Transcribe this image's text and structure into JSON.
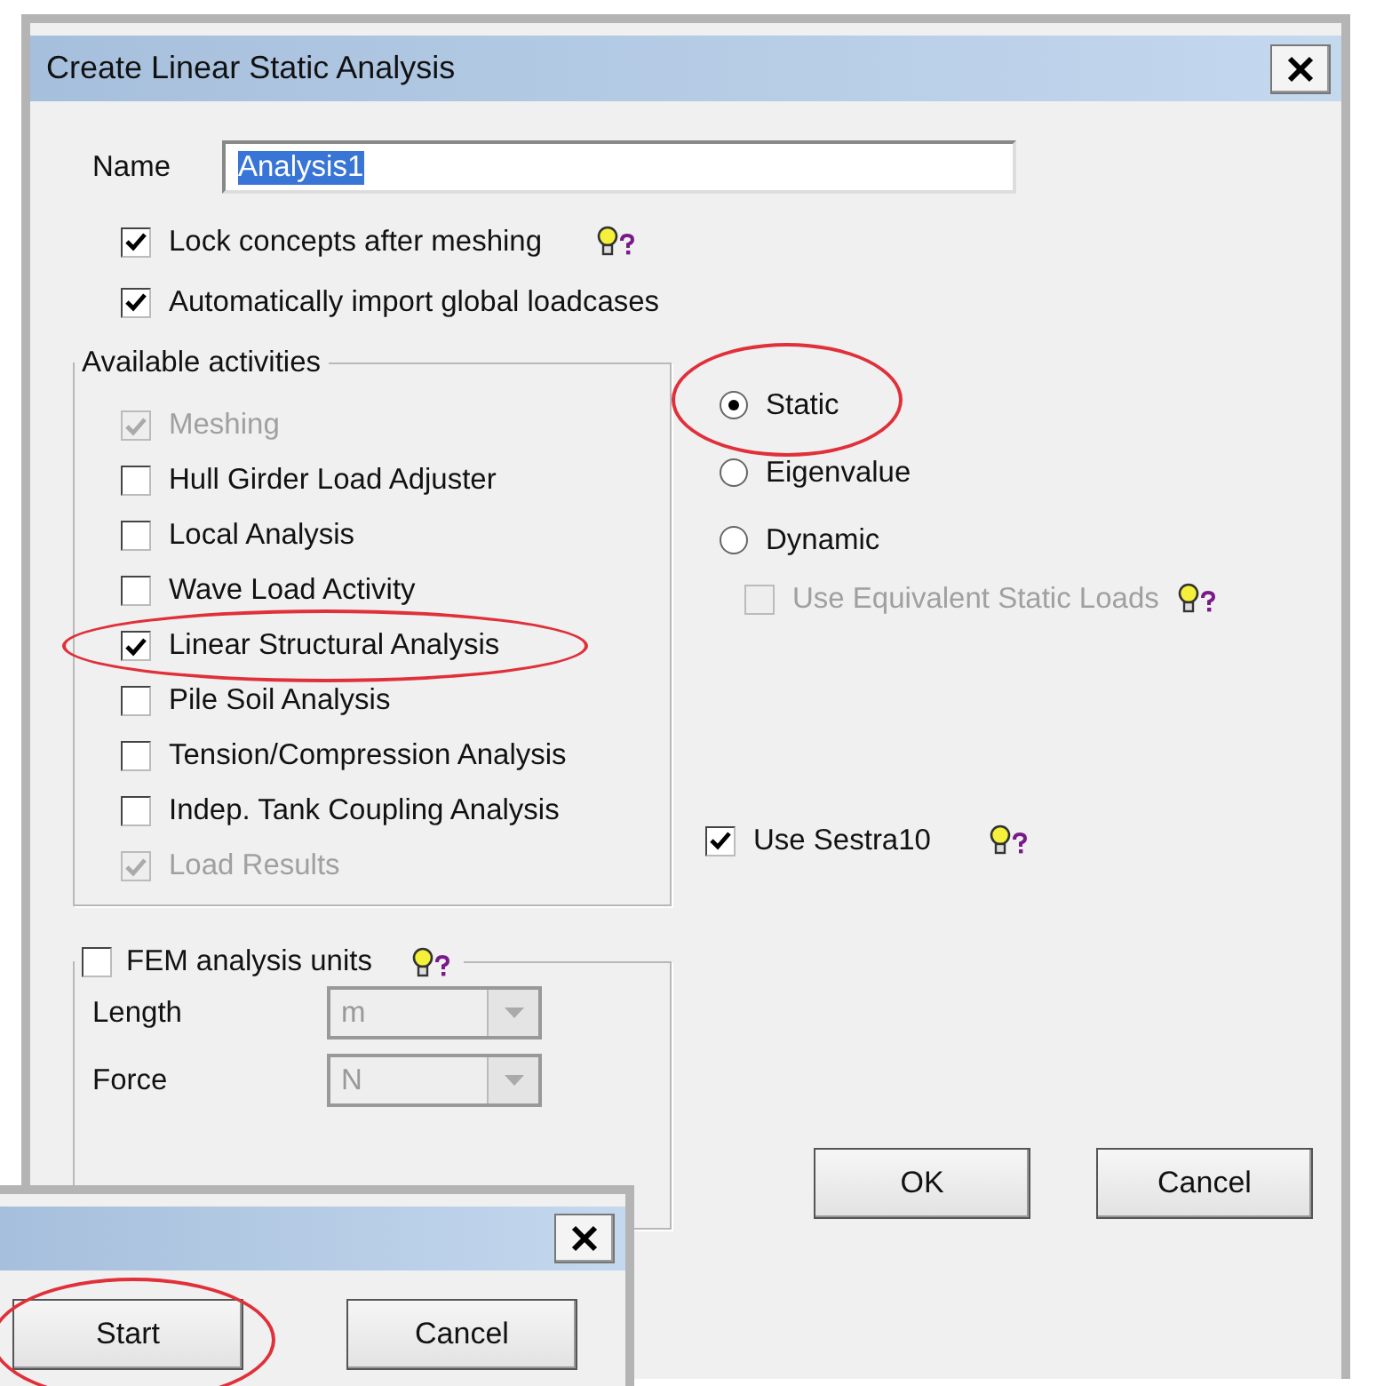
{
  "window": {
    "title": "Create Linear Static Analysis"
  },
  "name_field": {
    "label": "Name",
    "value": "Analysis1",
    "text_selected": true
  },
  "options": [
    {
      "label": "Lock concepts after meshing",
      "checked": true,
      "hint": true
    },
    {
      "label": "Automatically import global loadcases",
      "checked": true,
      "hint": false
    }
  ],
  "activities": {
    "title": "Available activities",
    "items": [
      {
        "label": "Meshing",
        "checked": true,
        "disabled": true,
        "highlighted": false
      },
      {
        "label": "Hull Girder Load Adjuster",
        "checked": false,
        "disabled": false,
        "highlighted": false
      },
      {
        "label": "Local Analysis",
        "checked": false,
        "disabled": false,
        "highlighted": false
      },
      {
        "label": "Wave Load Activity",
        "checked": false,
        "disabled": false,
        "highlighted": false
      },
      {
        "label": "Linear Structural Analysis",
        "checked": true,
        "disabled": false,
        "highlighted": true
      },
      {
        "label": "Pile Soil Analysis",
        "checked": false,
        "disabled": false,
        "highlighted": false
      },
      {
        "label": "Tension/Compression Analysis",
        "checked": false,
        "disabled": false,
        "highlighted": false
      },
      {
        "label": "Indep. Tank Coupling Analysis",
        "checked": false,
        "disabled": false,
        "highlighted": false
      },
      {
        "label": "Load Results",
        "checked": true,
        "disabled": true,
        "highlighted": false
      }
    ]
  },
  "analysis_types": [
    {
      "label": "Static",
      "selected": true,
      "highlighted": true
    },
    {
      "label": "Eigenvalue",
      "selected": false,
      "highlighted": false
    },
    {
      "label": "Dynamic",
      "selected": false,
      "highlighted": false
    }
  ],
  "equivalent_loads": {
    "label": "Use Equivalent Static Loads",
    "checked": false,
    "disabled": true,
    "hint": true
  },
  "sestra": {
    "label": "Use Sestra10",
    "checked": true,
    "disabled": false,
    "hint": true
  },
  "fem_units": {
    "label": "FEM analysis units",
    "checked": false,
    "hint": true,
    "fields": [
      {
        "label": "Length",
        "value": "m",
        "disabled": true
      },
      {
        "label": "Force",
        "value": "N",
        "disabled": true
      }
    ]
  },
  "buttons": [
    {
      "label": "OK"
    },
    {
      "label": "Cancel"
    }
  ],
  "overlay_dialog": {
    "buttons": [
      {
        "label": "Start",
        "highlighted": true
      },
      {
        "label": "Cancel",
        "highlighted": false
      }
    ]
  }
}
